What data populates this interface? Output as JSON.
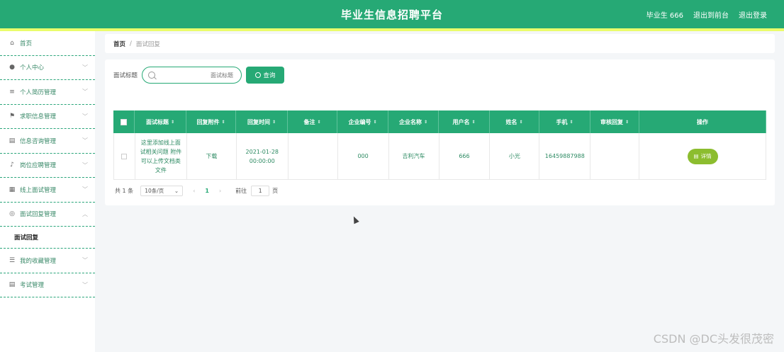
{
  "header": {
    "title": "毕业生信息招聘平台",
    "user_label": "毕业生 666",
    "to_front_label": "退出到前台",
    "logout_label": "退出登录"
  },
  "sidebar": {
    "items": [
      {
        "label": "首页",
        "icon": "home-icon",
        "chevron": false
      },
      {
        "label": "个人中心",
        "icon": "user-icon",
        "chevron": true
      },
      {
        "label": "个人简历管理",
        "icon": "list-icon",
        "chevron": true
      },
      {
        "label": "求职信息管理",
        "icon": "flag-icon",
        "chevron": true
      },
      {
        "label": "信息咨询管理",
        "icon": "clipboard-icon",
        "chevron": true
      },
      {
        "label": "岗位应聘管理",
        "icon": "mic-icon",
        "chevron": true
      },
      {
        "label": "线上面试管理",
        "icon": "grid-icon",
        "chevron": true
      },
      {
        "label": "面试回复管理",
        "icon": "circle-icon",
        "chevron": true,
        "expanded": true
      }
    ],
    "sub_item": "面试回复",
    "items_after": [
      {
        "label": "我的收藏管理",
        "icon": "sliders-icon",
        "chevron": true
      },
      {
        "label": "考试管理",
        "icon": "clipboard-icon",
        "chevron": true
      }
    ]
  },
  "breadcrumb": {
    "home": "首页",
    "separator": "/",
    "current": "面试回复"
  },
  "search": {
    "label": "面试标题",
    "placeholder": "面试标题",
    "button_label": "查询"
  },
  "table": {
    "headers": [
      "面试标题",
      "回复附件",
      "回复时间",
      "备注",
      "企业编号",
      "企业名称",
      "用户名",
      "姓名",
      "手机",
      "审核回复",
      "操作"
    ],
    "rows": [
      {
        "title": "这里添加线上面试相关问题 附件可以上传文档类文件",
        "attachment": "下载",
        "time": "2021-01-28 00:00:00",
        "note": "",
        "company_id": "000",
        "company_name": "吉利汽车",
        "username": "666",
        "name": "小光",
        "phone": "16459887988",
        "review": "",
        "action_label": "详情"
      }
    ]
  },
  "pager": {
    "total": "共 1 条",
    "page_size": "10条/页",
    "prev": "‹",
    "current_page": "1",
    "next": "›",
    "goto_label": "前往",
    "goto_value": "1",
    "unit": "页"
  },
  "watermark": "CSDN @DC头发很茂密",
  "colors": {
    "primary": "#26a975",
    "accent_strip": "#eafc6b",
    "detail_button": "#8cbd2f"
  }
}
